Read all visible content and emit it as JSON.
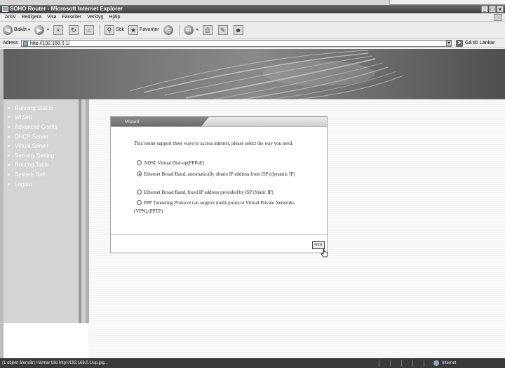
{
  "window": {
    "title": "SOHO Router - Microsoft Internet Explorer",
    "controls": [
      "_",
      "□",
      "×"
    ]
  },
  "menubar": {
    "items": [
      "Arkiv",
      "Redigera",
      "Visa",
      "Favoriter",
      "Verktyg",
      "Hjälp"
    ]
  },
  "toolbar": {
    "back_label": "Bakåt",
    "search_label": "Sök",
    "favorites_label": "Favoriter"
  },
  "addressbar": {
    "label": "Adress",
    "url": "http://192.168.0.1/",
    "go_label": "Gå till",
    "links_label": "Länkar"
  },
  "sidebar": {
    "items": [
      {
        "label": "Running Status"
      },
      {
        "label": "Wizard"
      },
      {
        "label": "Advanced Config"
      },
      {
        "label": "DHCP Server"
      },
      {
        "label": "Virtual Server"
      },
      {
        "label": "Security Setting"
      },
      {
        "label": "Routing Table"
      },
      {
        "label": "System Tool"
      },
      {
        "label": "Logout"
      }
    ]
  },
  "wizard": {
    "title": "Wizard",
    "intro": "This router support three ways to access internet, please select the way you need.",
    "options": [
      {
        "label": "ADSL Virtual Dial-up(PPPoE)",
        "selected": false
      },
      {
        "label": "Ethernet Broad Band, automatically obtain IP address from ISP (dynamic IP)",
        "selected": true
      },
      {
        "label": "Ethernet Broad Band, fixed IP address provided by ISP (Static IP)",
        "selected": false
      },
      {
        "label": "PPP Tunneling Protocol can support multi-protocol Virtual Private Networks (VPN).(PPTP)",
        "selected": false
      }
    ],
    "next_label": "Next"
  },
  "statusbar": {
    "text": "(1 objekt återstår) Hämtar bild http://192.168.0.1/up.jpg...",
    "zone": "Internet"
  },
  "colors": {
    "titlebar": "#4a4a4a",
    "sidebar_bg": "#d4d4d4",
    "sidebar_text": "#ffffff",
    "banner": "#6e6e6e"
  }
}
